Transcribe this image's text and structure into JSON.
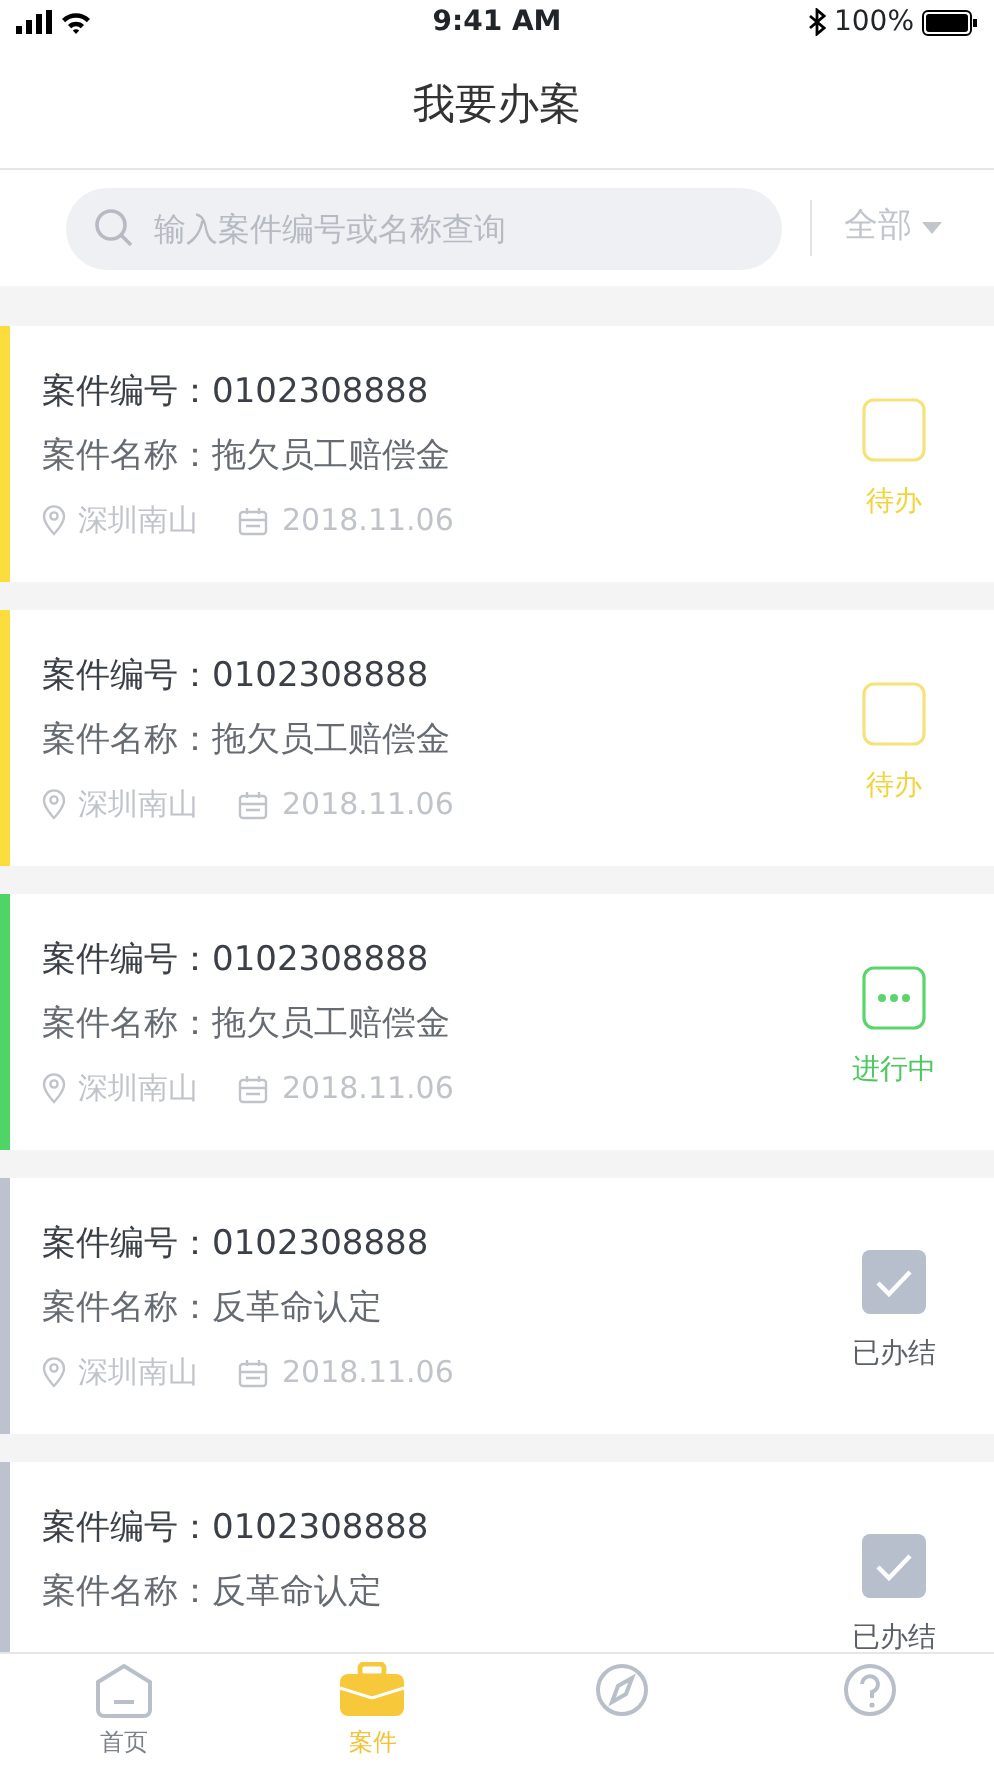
{
  "status_bar": {
    "time": "9:41 AM",
    "battery": "100%"
  },
  "header": {
    "title": "我要办案"
  },
  "search": {
    "placeholder": "输入案件编号或名称查询",
    "filter": "全部"
  },
  "cases": [
    {
      "number": "案件编号：0102308888",
      "name": "案件名称：拖欠员工赔偿金",
      "location": "深圳南山",
      "date": "2018.11.06",
      "color": "#fbdd3d",
      "status": {
        "kind": "pending",
        "label": "待办"
      }
    },
    {
      "number": "案件编号：0102308888",
      "name": "案件名称：拖欠员工赔偿金",
      "location": "深圳南山",
      "date": "2018.11.06",
      "color": "#fbdd3d",
      "status": {
        "kind": "pending",
        "label": "待办"
      }
    },
    {
      "number": "案件编号：0102308888",
      "name": "案件名称：拖欠员工赔偿金",
      "location": "深圳南山",
      "date": "2018.11.06",
      "color": "#4fd466",
      "status": {
        "kind": "progress",
        "label": "进行中"
      }
    },
    {
      "number": "案件编号：0102308888",
      "name": "案件名称：反革命认定",
      "location": "深圳南山",
      "date": "2018.11.06",
      "color": "#bcc3cf",
      "status": {
        "kind": "done",
        "label": "已办结"
      }
    },
    {
      "number": "案件编号：0102308888",
      "name": "案件名称：反革命认定",
      "color": "#bcc3cf",
      "status": {
        "kind": "done",
        "label": "已办结"
      }
    }
  ],
  "tabs": [
    {
      "kind": "home",
      "label": "首页",
      "selected": false
    },
    {
      "kind": "case",
      "label": "案件",
      "selected": true
    },
    {
      "kind": "guide",
      "selected": false
    },
    {
      "kind": "help",
      "selected": false
    }
  ]
}
